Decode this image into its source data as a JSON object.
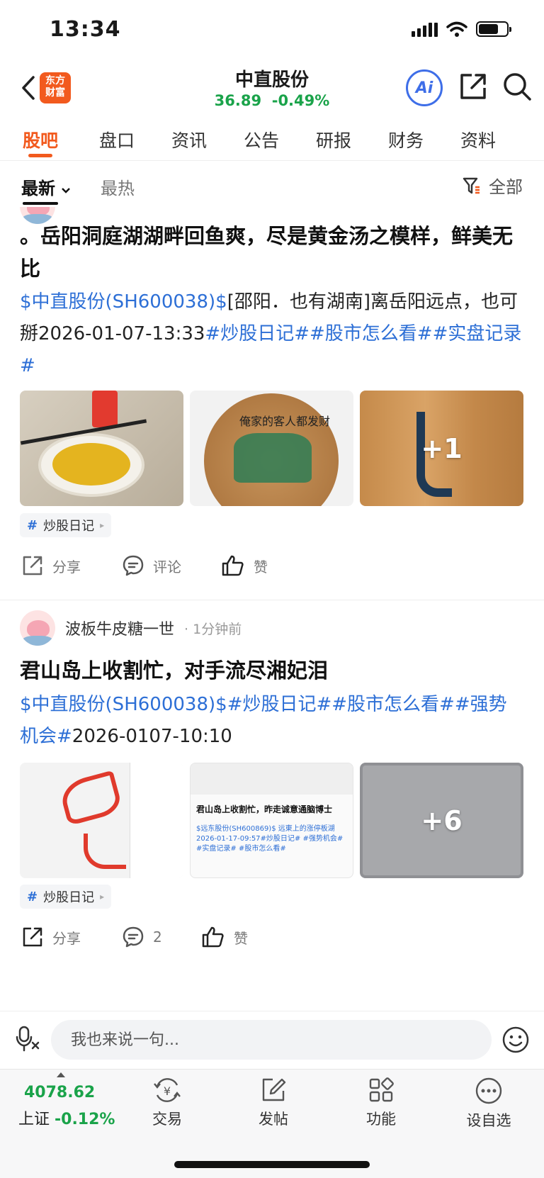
{
  "status_bar": {
    "time": "13:34"
  },
  "header": {
    "logo_line1": "东方",
    "logo_line2": "财富",
    "stock_name": "中直股份",
    "price": "36.89",
    "change": "-0.49%",
    "ai_label": "Ai"
  },
  "tabs": [
    {
      "label": "股吧",
      "active": true
    },
    {
      "label": "盘口"
    },
    {
      "label": "资讯"
    },
    {
      "label": "公告"
    },
    {
      "label": "研报"
    },
    {
      "label": "财务"
    },
    {
      "label": "资料"
    }
  ],
  "filter": {
    "latest": "最新",
    "hot": "最热",
    "all": "全部"
  },
  "posts": [
    {
      "title": "。岳阳洞庭湖湖畔回鱼爽，尽是黄金汤之模样，鲜美无比",
      "body_stock": "$中直股份(SH600038)$",
      "body_text": "[邵阳．也有湖南]离岳阳远点，也可掰2026-01-07-13:33",
      "body_tags": "#炒股日记##股市怎么看##实盘记录#",
      "more_images": "+1",
      "topic": "炒股日记",
      "share": "分享",
      "comment": "评论",
      "like": "赞",
      "image3_text": "俺家的客人都发财"
    },
    {
      "author": "波板牛皮糖一世",
      "time": "1分钟前",
      "title": "君山岛上收割忙，对手流尽湘妃泪",
      "body_stock": "$中直股份(SH600038)$",
      "body_tags": "#炒股日记##股市怎么看##强势机会#",
      "body_text": "2026-0107-10:10",
      "shot_title": "君山岛上收割忙，昨走诚意通脑博士",
      "shot_body": "$远东股份(SH600869)$ 远東上的涨停板湖2026-01-17-09:57#炒股日记# #强势机会# #实盘记录# #股市怎么看#",
      "more_images": "+6",
      "topic": "炒股日记",
      "share": "分享",
      "comment": "2",
      "like": "赞"
    }
  ],
  "comment_bar": {
    "placeholder": "我也来说一句..."
  },
  "bottom_nav": {
    "index_value": "4078.62",
    "index_name": "上证",
    "index_change": "-0.12%",
    "items": [
      {
        "label": "交易",
        "icon": "trade-icon"
      },
      {
        "label": "发帖",
        "icon": "post-icon"
      },
      {
        "label": "功能",
        "icon": "apps-icon"
      },
      {
        "label": "设自选",
        "icon": "more-icon"
      }
    ]
  },
  "colors": {
    "accent": "#f25a1e",
    "link": "#2d6fd6",
    "down_green": "#1aa34a",
    "ai_blue": "#3e6ee8"
  }
}
